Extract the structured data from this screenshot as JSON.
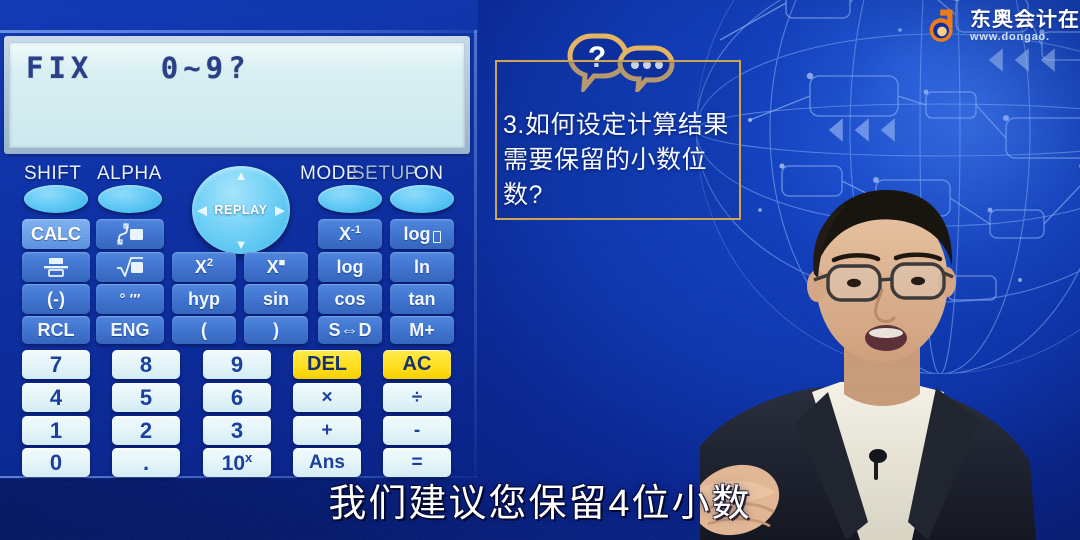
{
  "background": {
    "base_color": "#0a2a9a",
    "accent_glow": "#1646c8",
    "pattern": "circuit-globe"
  },
  "logo": {
    "mark": "dongao-d-mark",
    "mark_color": "#f07a15",
    "brand_cn": "东奥会计在",
    "url": "www.dongao."
  },
  "calculator": {
    "display": {
      "line1": "FIX   0~9?"
    },
    "function_labels": [
      {
        "name": "shift",
        "text": "SHIFT",
        "dim": false
      },
      {
        "name": "alpha",
        "text": "ALPHA",
        "dim": false
      },
      {
        "name": "mode",
        "text": "MODE",
        "dim": false
      },
      {
        "name": "setup",
        "text": "SETUP",
        "dim": true
      },
      {
        "name": "on",
        "text": "ON",
        "dim": false
      }
    ],
    "replay": {
      "label": "REPLAY",
      "arrows": [
        "up",
        "right",
        "down",
        "left"
      ]
    },
    "function_keys": [
      {
        "name": "calc",
        "label": "CALC",
        "highlighted": true
      },
      {
        "name": "integral",
        "label": "∫",
        "glyph": "integral-box"
      },
      {
        "name": "x-inverse",
        "label": "X",
        "sup": "-1"
      },
      {
        "name": "log-base",
        "label": "log",
        "glyph": "sub-box"
      },
      {
        "name": "fraction",
        "label": "▤",
        "glyph": "fraction"
      },
      {
        "name": "sqrt",
        "label": "√",
        "glyph": "sqrt-box"
      },
      {
        "name": "x-squared",
        "label": "X",
        "sup": "2"
      },
      {
        "name": "x-power",
        "label": "X",
        "sup": "■"
      },
      {
        "name": "log",
        "label": "log"
      },
      {
        "name": "ln",
        "label": "ln"
      },
      {
        "name": "negative",
        "label": "(-)"
      },
      {
        "name": "dms",
        "label": "° ′″"
      },
      {
        "name": "hyp",
        "label": "hyp"
      },
      {
        "name": "sin",
        "label": "sin"
      },
      {
        "name": "cos",
        "label": "cos"
      },
      {
        "name": "tan",
        "label": "tan"
      },
      {
        "name": "rcl",
        "label": "RCL"
      },
      {
        "name": "eng",
        "label": "ENG"
      },
      {
        "name": "paren-open",
        "label": "("
      },
      {
        "name": "paren-close",
        "label": ")"
      },
      {
        "name": "s-to-d",
        "label": "S⇔D"
      },
      {
        "name": "m-plus",
        "label": "M+"
      }
    ],
    "keypad_rows": [
      [
        {
          "name": "seven",
          "label": "7",
          "type": "num"
        },
        {
          "name": "eight",
          "label": "8",
          "type": "num"
        },
        {
          "name": "nine",
          "label": "9",
          "type": "num"
        },
        {
          "name": "del",
          "label": "DEL",
          "type": "yellow"
        },
        {
          "name": "ac",
          "label": "AC",
          "type": "yellow"
        }
      ],
      [
        {
          "name": "four",
          "label": "4",
          "type": "num"
        },
        {
          "name": "five",
          "label": "5",
          "type": "num"
        },
        {
          "name": "six",
          "label": "6",
          "type": "num"
        },
        {
          "name": "multiply",
          "label": "×",
          "type": "op"
        },
        {
          "name": "divide",
          "label": "÷",
          "type": "op"
        }
      ],
      [
        {
          "name": "one",
          "label": "1",
          "type": "num"
        },
        {
          "name": "two",
          "label": "2",
          "type": "num"
        },
        {
          "name": "three",
          "label": "3",
          "type": "num"
        },
        {
          "name": "plus",
          "label": "+",
          "type": "op"
        },
        {
          "name": "minus",
          "label": "-",
          "type": "op"
        }
      ],
      [
        {
          "name": "zero",
          "label": "0",
          "type": "num"
        },
        {
          "name": "decimal",
          "label": ".",
          "type": "num"
        },
        {
          "name": "ten-power",
          "label": "10",
          "type": "op",
          "sup": "x"
        },
        {
          "name": "ans",
          "label": "Ans",
          "type": "op"
        },
        {
          "name": "equals",
          "label": "=",
          "type": "op"
        }
      ]
    ]
  },
  "question_card": {
    "border_color": "#c9a45c",
    "icon": "question-speech-bubbles",
    "text": "3.如何设定计算结果需要保留的小数位数?"
  },
  "subtitle": {
    "text": "我们建议您保留4位小数"
  },
  "presenter": {
    "description": "male-lecturer-with-glasses"
  }
}
